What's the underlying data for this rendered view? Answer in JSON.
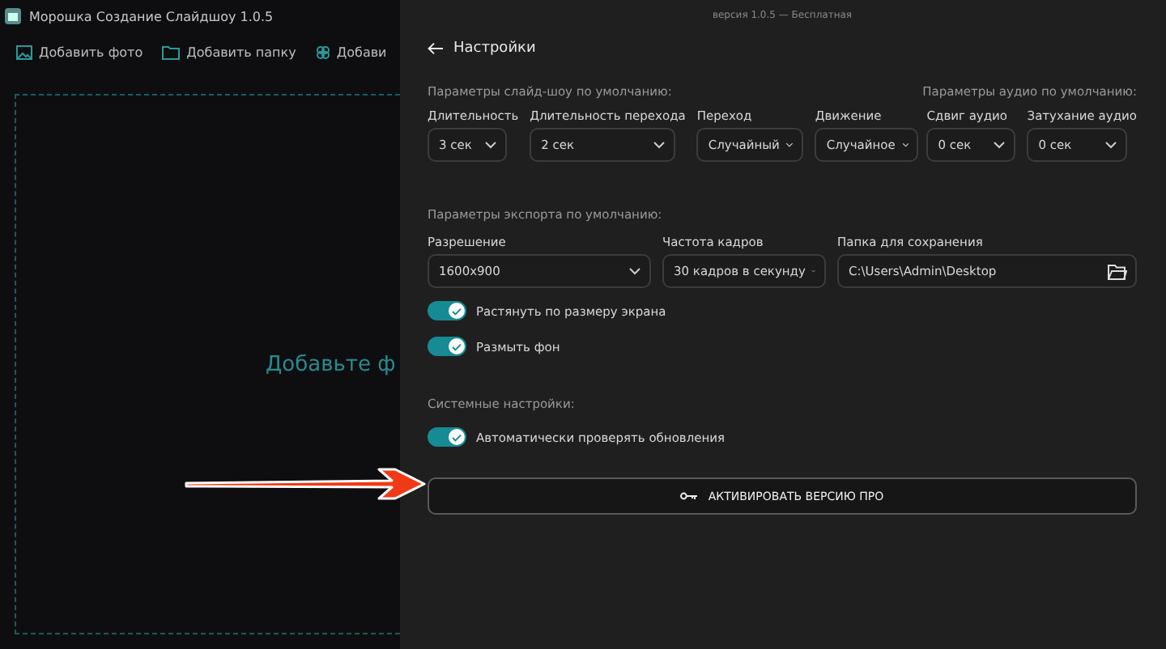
{
  "app": {
    "title": "Морошка Создание Слайдшоу 1.0.5"
  },
  "toolbar": [
    {
      "label": "Добавить фото",
      "kind": "photo"
    },
    {
      "label": "Добавить папку",
      "kind": "folder"
    },
    {
      "label": "Добави",
      "kind": "effects"
    }
  ],
  "drop_zone": {
    "hint": "Добавьте ф"
  },
  "settings": {
    "version": "версия 1.0.5 — Бесплатная",
    "title": "Настройки",
    "slideshow_section": "Параметры слайд-шоу по умолчанию:",
    "audio_section": "Параметры аудио по умолчанию:",
    "slideshow_fields": [
      {
        "label": "Длительность",
        "value": "3 сек"
      },
      {
        "label": "Длительность перехода",
        "value": "2 сек"
      },
      {
        "label": "Переход",
        "value": "Случайный"
      },
      {
        "label": "Движение",
        "value": "Случайное"
      }
    ],
    "audio_fields": [
      {
        "label": "Сдвиг аудио",
        "value": "0 сек"
      },
      {
        "label": "Затухание аудио",
        "value": "0 сек"
      }
    ],
    "export_section": "Параметры экспорта по умолчанию:",
    "export_fields": [
      {
        "label": "Разрешение",
        "value": "1600x900",
        "kind": "select"
      },
      {
        "label": "Частота кадров",
        "value": "30 кадров в секунду",
        "kind": "select"
      },
      {
        "label": "Папка для сохранения",
        "value": "C:\\Users\\Admin\\Desktop",
        "kind": "folder"
      }
    ],
    "export_toggles": [
      {
        "label": "Растянуть по размеру экрана",
        "on": true
      },
      {
        "label": "Размыть фон",
        "on": true
      }
    ],
    "system_section": "Системные настройки:",
    "system_toggles": [
      {
        "label": "Автоматически проверять обновления",
        "on": true
      }
    ],
    "activate_button": "АКТИВИРОВАТЬ ВЕРСИЮ ПРО"
  }
}
